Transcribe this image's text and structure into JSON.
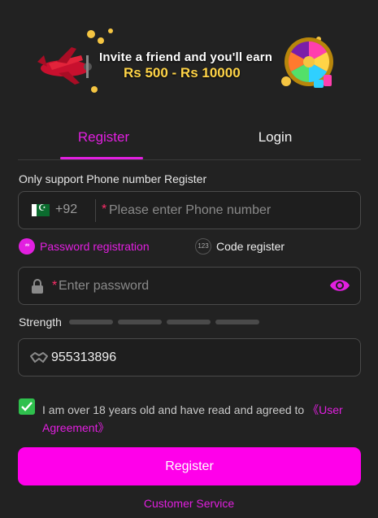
{
  "banner": {
    "line1": "Invite a friend and you'll earn",
    "line2": "Rs 500 - Rs 10000"
  },
  "tabs": [
    {
      "label": "Register",
      "active": true
    },
    {
      "label": "Login",
      "active": false
    }
  ],
  "form": {
    "support_label": "Only support Phone number Register",
    "phone": {
      "country_code": "+92",
      "required_mark": "*",
      "placeholder": "Please enter Phone number",
      "value": ""
    },
    "modes": {
      "password": {
        "icon_text": "**",
        "label": "Password registration",
        "selected": true
      },
      "code": {
        "icon_text": "123",
        "label": "Code register",
        "selected": false
      }
    },
    "password": {
      "required_mark": "*",
      "placeholder": "Enter password",
      "value": ""
    },
    "strength": {
      "label": "Strength",
      "filled_segments": 0,
      "total_segments": 4
    },
    "invite_code": {
      "value": "955313896"
    },
    "agreement": {
      "checked": true,
      "text": "I am over 18 years old and have read and agreed to ",
      "link_part1": "《User",
      "link_part2": "Agreement》"
    },
    "submit_label": "Register",
    "customer_service": "Customer Service"
  },
  "colors": {
    "accent": "#e21fe0",
    "button": "#ff00ea",
    "checkbox": "#2fc04d",
    "background": "#222222"
  },
  "icons": [
    "plane-icon",
    "roulette-wheel-icon",
    "pakistan-flag-icon",
    "lock-icon",
    "eye-icon",
    "handshake-icon",
    "checkmark-icon"
  ]
}
